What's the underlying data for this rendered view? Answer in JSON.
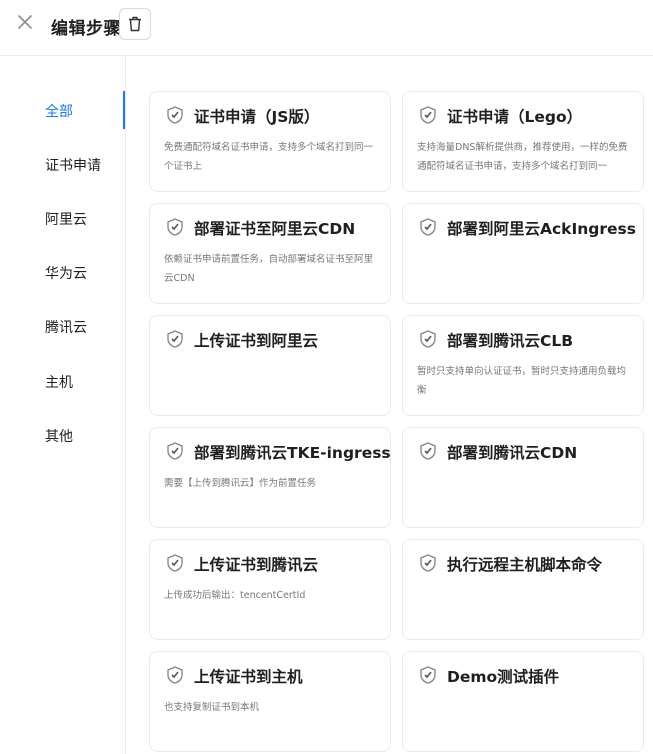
{
  "header": {
    "title": "编辑步骤"
  },
  "sidebar": {
    "items": [
      {
        "label": "全部",
        "active": true
      },
      {
        "label": "证书申请"
      },
      {
        "label": "阿里云"
      },
      {
        "label": "华为云"
      },
      {
        "label": "腾讯云"
      },
      {
        "label": "主机"
      },
      {
        "label": "其他"
      }
    ]
  },
  "cards": [
    {
      "title": "证书申请（JS版）",
      "desc": "免费通配符域名证书申请，支持多个域名打到同一个证书上"
    },
    {
      "title": "证书申请（Lego）",
      "desc": "支持海量DNS解析提供商，推荐使用，一样的免费通配符域名证书申请，支持多个域名打到同一"
    },
    {
      "title": "部署证书至阿里云CDN",
      "desc": "依赖证书申请前置任务，自动部署域名证书至阿里云CDN"
    },
    {
      "title": "部署到阿里云AckIngress",
      "desc": ""
    },
    {
      "title": "上传证书到阿里云",
      "desc": ""
    },
    {
      "title": "部署到腾讯云CLB",
      "desc": "暂时只支持单向认证证书，暂时只支持通用负载均衡"
    },
    {
      "title": "部署到腾讯云TKE-ingress",
      "desc": "需要【上传到腾讯云】作为前置任务"
    },
    {
      "title": "部署到腾讯云CDN",
      "desc": ""
    },
    {
      "title": "上传证书到腾讯云",
      "desc": "上传成功后输出：tencentCertId"
    },
    {
      "title": "执行远程主机脚本命令",
      "desc": ""
    },
    {
      "title": "上传证书到主机",
      "desc": "也支持复制证书到本机"
    },
    {
      "title": "Demo测试插件",
      "desc": ""
    }
  ],
  "colors": {
    "accent": "#1677ff",
    "border": "#ebebeb",
    "desc": "#777777"
  },
  "icons": {
    "close": "close-icon",
    "delete": "trash-icon",
    "plugin": "shield-badge-icon"
  }
}
